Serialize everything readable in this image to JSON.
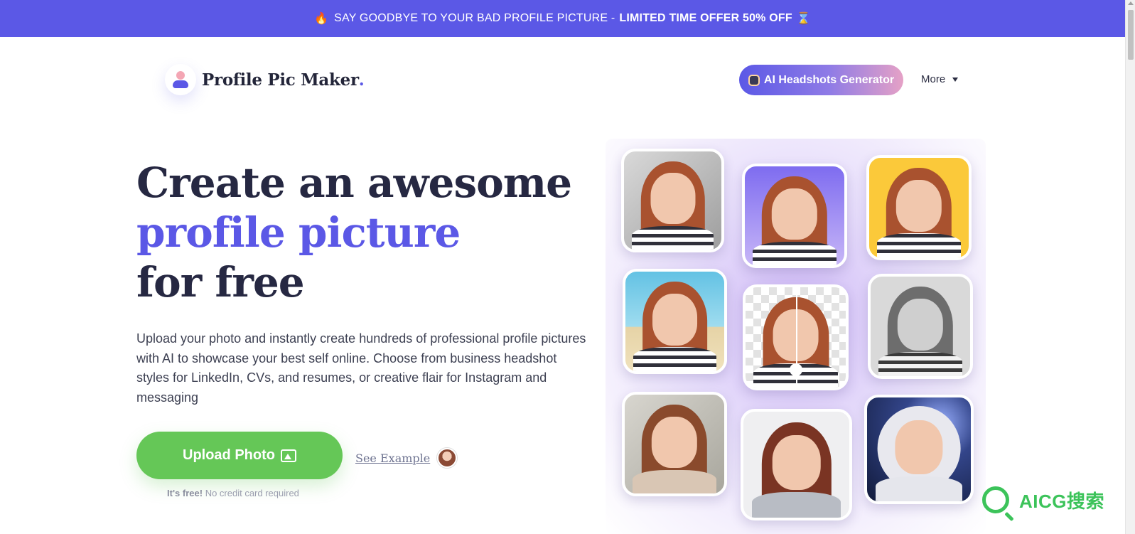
{
  "promo": {
    "fire_icon": "🔥",
    "text": "SAY GOODBYE TO YOUR BAD PROFILE PICTURE -",
    "highlight": "LIMITED TIME OFFER 50% OFF",
    "hourglass_icon": "⌛"
  },
  "header": {
    "logo_text": "Profile Pic Maker",
    "logo_dot": ".",
    "headshots_button": "AI Headshots Generator",
    "more_label": "More"
  },
  "hero": {
    "title_line1": "Create an awesome",
    "title_line2": "profile picture",
    "title_line3": "for free",
    "description": "Upload your photo and instantly create hundreds of professional profile pictures with AI to showcase your best self online. Choose from business headshot styles for LinkedIn, CVs, and resumes, or creative flair for Instagram and messaging",
    "upload_button": "Upload Photo",
    "see_example": "See Example",
    "free_strong": "It's free!",
    "free_rest": "No credit card required"
  },
  "collage": {
    "tiles": [
      {
        "style": "gray-studio",
        "bg": "#bdbdbd"
      },
      {
        "style": "purple-cutout",
        "bg": "#9c87f0"
      },
      {
        "style": "yellow",
        "bg": "#fbc93a"
      },
      {
        "style": "beach",
        "bg": "#6fc5e0"
      },
      {
        "style": "transparent-split",
        "bg": "#e8e8e8"
      },
      {
        "style": "black-and-white",
        "bg": "#d6d6d6"
      },
      {
        "style": "portrait-neutral",
        "bg": "#c9c7bf"
      },
      {
        "style": "business-suit",
        "bg": "#e9eaec"
      },
      {
        "style": "astronaut",
        "bg": "#1d2a55"
      }
    ]
  },
  "watermark": {
    "text": "AICG搜索"
  },
  "colors": {
    "brand": "#5b58e6",
    "cta_green": "#65c757",
    "heading": "#262842"
  }
}
